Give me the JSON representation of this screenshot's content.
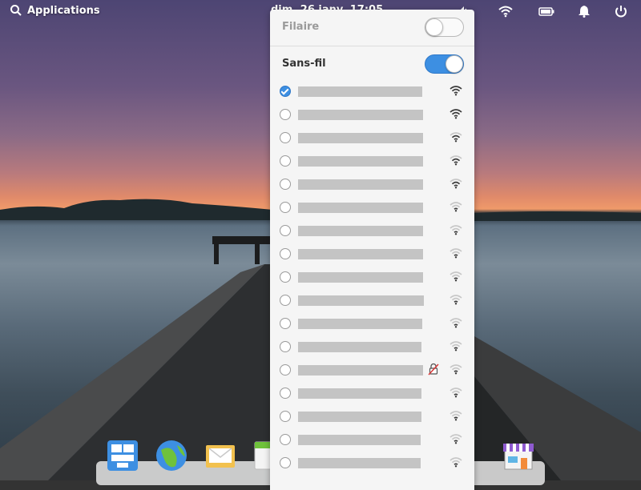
{
  "panel": {
    "applications_label": "Applications",
    "clock_text": "dim. 26 janv. 17:05"
  },
  "wired": {
    "label": "Filaire",
    "enabled": false
  },
  "wireless": {
    "label": "Sans-fil",
    "enabled": true
  },
  "networks": [
    {
      "connected": true,
      "signal": "strong",
      "secured": false
    },
    {
      "connected": false,
      "signal": "strong",
      "secured": false
    },
    {
      "connected": false,
      "signal": "good",
      "secured": false
    },
    {
      "connected": false,
      "signal": "good",
      "secured": false
    },
    {
      "connected": false,
      "signal": "good",
      "secured": false
    },
    {
      "connected": false,
      "signal": "weak",
      "secured": false
    },
    {
      "connected": false,
      "signal": "weak",
      "secured": false
    },
    {
      "connected": false,
      "signal": "weak",
      "secured": false
    },
    {
      "connected": false,
      "signal": "weak",
      "secured": false
    },
    {
      "connected": false,
      "signal": "weak",
      "secured": false
    },
    {
      "connected": false,
      "signal": "weak",
      "secured": false
    },
    {
      "connected": false,
      "signal": "weak",
      "secured": false
    },
    {
      "connected": false,
      "signal": "weak",
      "secured": true
    },
    {
      "connected": false,
      "signal": "weak",
      "secured": false
    },
    {
      "connected": false,
      "signal": "weak",
      "secured": false
    },
    {
      "connected": false,
      "signal": "weak",
      "secured": false
    },
    {
      "connected": false,
      "signal": "weak",
      "secured": false
    }
  ],
  "dock_items": [
    {
      "icon": "multitasking-view-icon"
    },
    {
      "icon": "web-browser-icon"
    },
    {
      "icon": "mail-icon"
    },
    {
      "icon": "calendar-icon"
    },
    {
      "icon": "app-center-icon"
    }
  ],
  "colors": {
    "accent": "#3d8fe2"
  }
}
